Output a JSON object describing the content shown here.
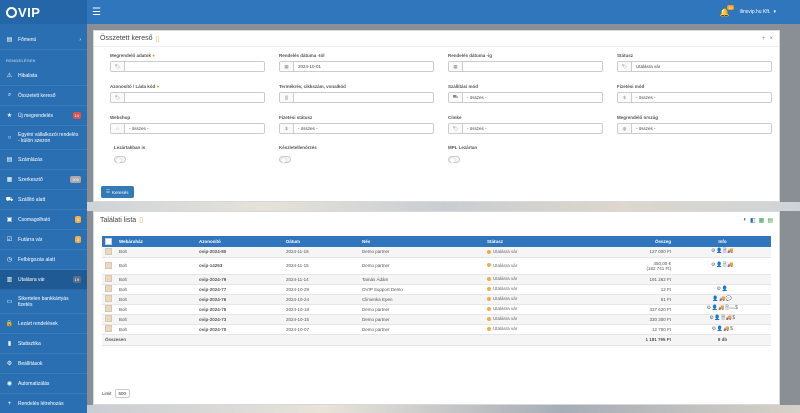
{
  "app": {
    "logo_text": "VIP"
  },
  "topbar": {
    "notif_count": "16",
    "user": "ilinsvip.hu Kft."
  },
  "sidebar": {
    "items": [
      {
        "label": "Főmenü",
        "icon": "dashboard-icon"
      }
    ],
    "section_title": "RENDELÉSEK",
    "orders": [
      {
        "label": "Hibalista",
        "icon": "warning-icon",
        "badge": ""
      },
      {
        "label": "Összetett kereső",
        "icon": "search-icon",
        "badge": ""
      },
      {
        "label": "Új megrendelés",
        "icon": "star-icon",
        "badge": "14"
      },
      {
        "label": "Egyéni vállalkozói rendelés - külön szezon",
        "icon": "circle-icon",
        "badge": ""
      },
      {
        "label": "Számlázás",
        "icon": "invoice-icon",
        "badge": ""
      },
      {
        "label": "Szerkesztő",
        "icon": "calendar-icon",
        "badge": "200"
      },
      {
        "label": "Szállító alatt",
        "icon": "truck-icon",
        "badge": ""
      },
      {
        "label": "Csomagolható",
        "icon": "box-icon",
        "badge": "3"
      },
      {
        "label": "Futárra vár",
        "icon": "check-icon",
        "badge": "3"
      },
      {
        "label": "Felbírgozás alatt",
        "icon": "clock-icon",
        "badge": ""
      },
      {
        "label": "Utalásra vár",
        "icon": "bank-icon",
        "badge": "19"
      },
      {
        "label": "Sikertelen bankkártyás fizetés",
        "icon": "card-icon",
        "badge": ""
      },
      {
        "label": "Lezárt rendelések",
        "icon": "lock-icon",
        "badge": ""
      },
      {
        "label": "Statisztika",
        "icon": "stats-icon",
        "badge": ""
      },
      {
        "label": "Beállítások",
        "icon": "gear-icon",
        "badge": ""
      },
      {
        "label": "Automatizálás",
        "icon": "robot-icon",
        "badge": ""
      },
      {
        "label": "Rendelés létrehozás",
        "icon": "plus-icon",
        "badge": ""
      }
    ]
  },
  "search": {
    "title": "Összetett kereső",
    "fields": {
      "customer": {
        "label": "Megrendelő adatok",
        "value": "",
        "icon": "tag-icon"
      },
      "date_from": {
        "label": "Rendelés dátuma -tól",
        "value": "2024-10-01",
        "icon": "calendar-icon"
      },
      "date_to": {
        "label": "Rendelés dátuma -ig",
        "value": "",
        "icon": "calendar-icon"
      },
      "status": {
        "label": "Státusz",
        "value": "Utalásra vár",
        "icon": "tag-icon"
      },
      "id": {
        "label": "Azonosító / Láda kód",
        "value": "",
        "icon": "tag-icon"
      },
      "product": {
        "label": "Termékrév, cikkszám, vonalkód",
        "value": "",
        "icon": "barcode-icon"
      },
      "shipping": {
        "label": "Szállítási mód",
        "value": "- összes -",
        "icon": "truck-icon"
      },
      "payment_method": {
        "label": "Fizetési mód",
        "value": "- összes -",
        "icon": "money-icon"
      },
      "webshop": {
        "label": "Webshop",
        "value": "- összes -",
        "icon": "shop-icon"
      },
      "payment_status": {
        "label": "Fizetési státusz",
        "value": "- összes -",
        "icon": "money-icon"
      },
      "tag": {
        "label": "Címke",
        "value": "- összes -",
        "icon": "tag-icon"
      },
      "country": {
        "label": "Megrendelő ország",
        "value": "- összes -",
        "icon": "globe-icon"
      }
    },
    "toggles": {
      "closed": "Lezártakban is",
      "stock": "Készletellenőrzés",
      "mpl": "MPL Lezártan"
    },
    "button": "Keresés"
  },
  "results": {
    "title": "Találati lista",
    "columns": [
      "Webáruház",
      "Azonosító",
      "Dátum",
      "Név",
      "Státusz",
      "Összeg",
      "Info"
    ],
    "rows": [
      {
        "shop": "Bolt",
        "id": "ovip-2024-80",
        "date": "2024-11-18",
        "name": "Demo partner",
        "status": "Utalásra vár",
        "amount": "127 000 Ft",
        "amount2": "",
        "info": "⚙👤🗎🚚"
      },
      {
        "shop": "Bolt",
        "id": "ovip-14253",
        "date": "2024-11-15",
        "name": "Demo partner",
        "status": "Utalásra vár",
        "amount": "450,00 €",
        "amount2": "(182 741 Ft)",
        "info": "⚙👤🗎🚚"
      },
      {
        "shop": "Bolt",
        "id": "ovip-2024-79",
        "date": "2024-11-14",
        "name": "Tamás Ádám",
        "status": "Utalásra vár",
        "amount": "191 262 Ft",
        "amount2": "",
        "info": ""
      },
      {
        "shop": "Bolt",
        "id": "ovip-2024-77",
        "date": "2024-10-29",
        "name": "OVIP Support Demo",
        "status": "Utalásra vár",
        "amount": "12 Ft",
        "amount2": "",
        "info": "⚙👤"
      },
      {
        "shop": "Bolt",
        "id": "ovip-2024-76",
        "date": "2024-10-24",
        "name": "Climenka Epen",
        "status": "Utalásra vár",
        "amount": "51 Ft",
        "amount2": "",
        "info": "👤🚚💬"
      },
      {
        "shop": "Bolt",
        "id": "ovip-2024-75",
        "date": "2024-10-18",
        "name": "Demo partner",
        "status": "Utalásra vár",
        "amount": "337 620 Ft",
        "amount2": "",
        "info": "⚙👤🚚🗎▭$"
      },
      {
        "shop": "Bolt",
        "id": "ovip-2024-73",
        "date": "2024-10-15",
        "name": "Demo partner",
        "status": "Utalásra vár",
        "amount": "330 300 Ft",
        "amount2": "",
        "info": "⚙👤🗎🚚$"
      },
      {
        "shop": "Bolt",
        "id": "ovip-2024-70",
        "date": "2024-10-07",
        "name": "Demo partner",
        "status": "Utalásra vár",
        "amount": "12 700 Ft",
        "amount2": "",
        "info": "⚙👤🚚$"
      }
    ],
    "footer": {
      "label": "Összesen",
      "total": "1 181 795 Ft",
      "count": "8 db"
    },
    "limit_label": "Limit",
    "limit_value": "500"
  }
}
